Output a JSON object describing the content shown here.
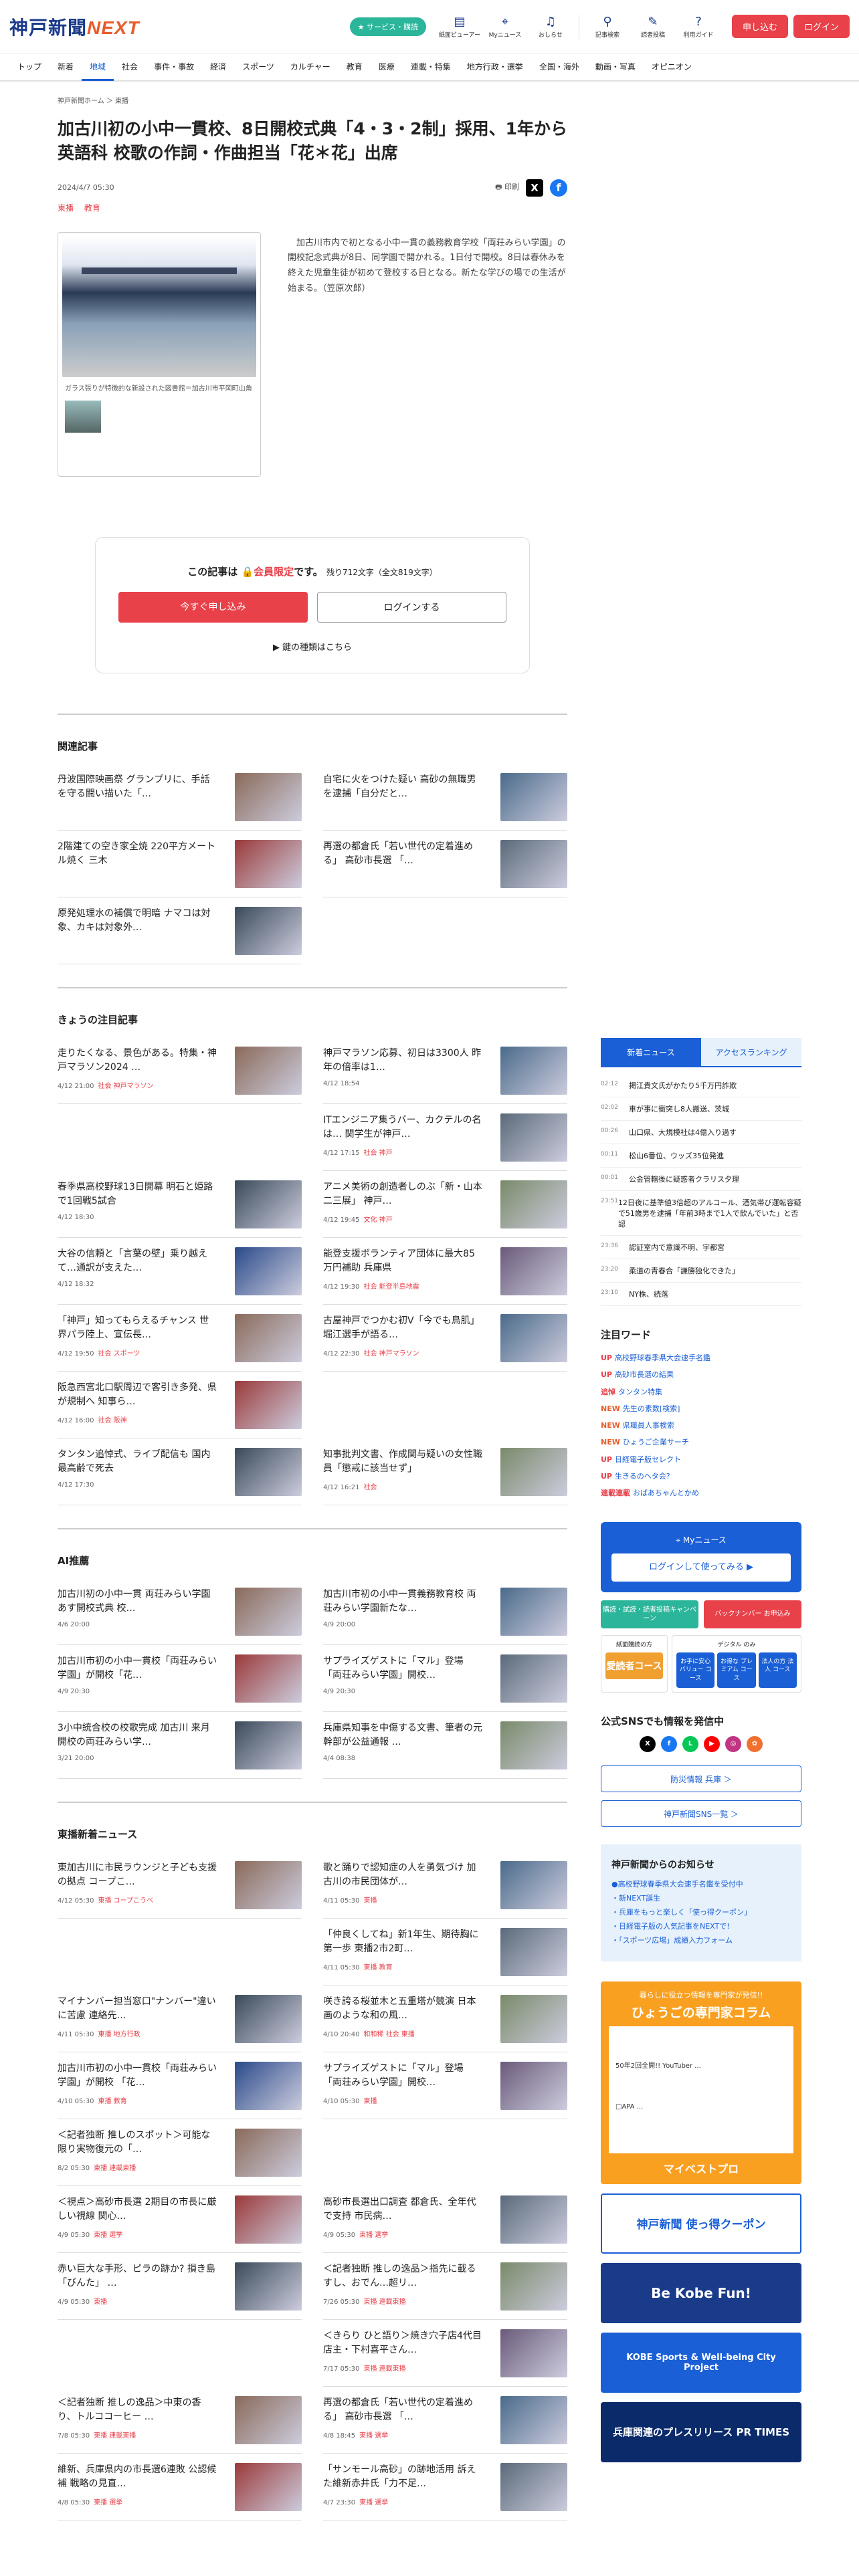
{
  "header": {
    "logo_main": "神戸新聞",
    "logo_sub": "NEXT",
    "service_pill": "★ サービス・購読",
    "icons": [
      {
        "icon": "newspaper-icon",
        "label": "紙面ビューアー"
      },
      {
        "icon": "my-news-icon",
        "label": "Myニュース"
      },
      {
        "icon": "bell-icon",
        "label": "おしらせ"
      }
    ],
    "icons2": [
      {
        "icon": "search-icon",
        "label": "記事検索"
      },
      {
        "icon": "pin-icon",
        "label": "読者投稿"
      },
      {
        "icon": "help-icon",
        "label": "利用ガイド"
      }
    ],
    "signup": "申し込む",
    "login": "ログイン"
  },
  "nav": [
    "トップ",
    "新着",
    "地域",
    "社会",
    "事件・事故",
    "経済",
    "スポーツ",
    "カルチャー",
    "教育",
    "医療",
    "連載・特集",
    "地方行政・選挙",
    "全国・海外",
    "動画・写真",
    "オピニオン"
  ],
  "nav_active": "地域",
  "article": {
    "breadcrumb": "神戸新聞ホーム ＞ 東播",
    "title": "加古川初の小中一貫校、8日開校式典「4・3・2制」採用、1年から英語科 校歌の作詞・作曲担当「花＊花」出席",
    "date": "2024/4/7 05:30",
    "print": "印刷",
    "tags": [
      "東播",
      "教育"
    ],
    "photo_caption": "ガラス張りが特徴的な新設された図書館＝加古川市平岡町山角",
    "lead": "加古川市内で初となる小中一貫の義務教育学校「両荘みらい学園」の開校記念式典が8日、同学園で開かれる。1日付で開校。8日は春休みを終えた児童生徒が初めて登校する日となる。新たな学びの場での生活が始まる。（笠原次郎）"
  },
  "paywall": {
    "msg_prefix": "この記事は",
    "msg_red": "会員限定",
    "msg_suffix": "です。",
    "remain": "残り712文字（全文819文字）",
    "apply": "今すぐ申し込み",
    "login": "ログインする",
    "key_link": "▶ 鍵の種類はこちら"
  },
  "related": {
    "heading": "関連記事",
    "items": [
      {
        "title": "丹波国際映画祭 グランプリに、手話を守る闘い描いた「…"
      },
      {
        "title": "自宅に火をつけた疑い 高砂の無職男を逮捕「自分だと…"
      },
      {
        "title": "2階建ての空き家全焼 220平方メートル焼く 三木"
      },
      {
        "title": "再選の都倉氏「若い世代の定着進める」 高砂市長選 「…"
      },
      {
        "title": "原発処理水の補償で明暗 ナマコは対象、カキは対象外…"
      }
    ]
  },
  "featured": {
    "heading": "きょうの注目記事",
    "items": [
      {
        "title": "走りたくなる、景色がある。特集・神戸マラソン2024 …",
        "time": "4/12 21:00",
        "cat": "社会 神戸マラソン"
      },
      {
        "title": "神戸マラソン応募、初日は3300人 昨年の倍率は1…",
        "time": "4/12 18:54",
        "cat": ""
      },
      {
        "title": "",
        "time": "",
        "cat": ""
      },
      {
        "title": "ITエンジニア集うバー、カクテルの名は… 関学生が神戸…",
        "time": "4/12 17:15",
        "cat": "社会 神戸"
      },
      {
        "title": "春季県高校野球13日開幕 明石と姫路で1回戦5試合",
        "time": "4/12 18:30",
        "cat": ""
      },
      {
        "title": "アニメ美術の創造者しのぶ「新・山本二三展」 神戸…",
        "time": "4/12 19:45",
        "cat": "文化 神戸"
      },
      {
        "title": "大谷の信頼と「言葉の壁」乗り越えて…通訳が支えた…",
        "time": "4/12 18:32",
        "cat": ""
      },
      {
        "title": "能登支援ボランティア団体に最大85万円補助 兵庫県",
        "time": "4/12 19:30",
        "cat": "社会 能登半島地震"
      },
      {
        "title": "「神戸」知ってもらえるチャンス 世界パラ陸上、宣伝長…",
        "time": "4/12 19:50",
        "cat": "社会 スポーツ"
      },
      {
        "title": "古屋神戸でつかむ初V「今でも鳥肌」 堀江選手が語る…",
        "time": "4/12 22:30",
        "cat": "社会 神戸マラソン"
      },
      {
        "title": "阪急西宮北口駅周辺で客引き多発、県が規制へ 知事ら…",
        "time": "4/12 16:00",
        "cat": "社会 阪神"
      },
      {
        "title": "",
        "time": "",
        "cat": ""
      },
      {
        "title": "タンタン追悼式、ライブ配信も 国内最高齢で死去",
        "time": "4/12 17:30",
        "cat": ""
      },
      {
        "title": "知事批判文書、作成関与疑いの女性職員「懲戒に該当せず」",
        "time": "4/12 16:21",
        "cat": "社会"
      }
    ]
  },
  "ai": {
    "heading": "AI推薦",
    "items": [
      {
        "title": "加古川初の小中一貫 両荘みらい学園 あす開校式典 校…",
        "time": "4/6 20:00",
        "cat": ""
      },
      {
        "title": "加古川市初の小中一貫義務教育校 両荘みらい学園新たな…",
        "time": "4/9 20:00",
        "cat": ""
      },
      {
        "title": "加古川市初の小中一貫校「両荘みらい学園」が開校「花…",
        "time": "4/9 20:30",
        "cat": ""
      },
      {
        "title": "サプライズゲストに「マル」登場 「両荘みらい学園」開校…",
        "time": "4/9 20:30",
        "cat": ""
      },
      {
        "title": "3小中統合校の校歌完成 加古川 来月開校の両荘みらい学…",
        "time": "3/21 20:00",
        "cat": ""
      },
      {
        "title": "兵庫県知事を中傷する文書、筆者の元幹部が公益通報 …",
        "time": "4/4 08:38",
        "cat": ""
      }
    ]
  },
  "tohban": {
    "heading": "東播新着ニュース",
    "items": [
      {
        "title": "東加古川に市民ラウンジと子ども支援の拠点 コープこ…",
        "time": "4/12 05:30",
        "cat": "東播 コープこうべ"
      },
      {
        "title": "歌と踊りで認知症の人を勇気づけ 加古川の市民団体が…",
        "time": "4/11 05:30",
        "cat": "東播"
      },
      {
        "title": "",
        "time": "",
        "cat": ""
      },
      {
        "title": "「仲良くしてね」新1年生、期待胸に第一歩 東播2市2町…",
        "time": "4/11 05:30",
        "cat": "東播 教育"
      },
      {
        "title": "マイナンバー担当窓口\"ナンバー\"違いに苦慮 連絡先…",
        "time": "4/11 05:30",
        "cat": "東播 地方行政"
      },
      {
        "title": "咲き誇る桜並木と五重塔が競演 日本画のような和の風…",
        "time": "4/10 20:40",
        "cat": "和和稀 社会 東播"
      },
      {
        "title": "加古川市初の小中一貫校「両荘みらい学園」が開校 「花…",
        "time": "4/10 05:30",
        "cat": "東播 教育"
      },
      {
        "title": "サプライズゲストに「マル」登場 「両荘みらい学園」開校…",
        "time": "4/10 05:30",
        "cat": "東播"
      },
      {
        "title": "＜記者独断 推しのスポット＞可能な限り実物復元の「…",
        "time": "8/2 05:30",
        "cat": "東播 連載東播"
      },
      {
        "title": "",
        "time": "",
        "cat": ""
      },
      {
        "title": "＜視点＞高砂市長選 2期目の市長に厳しい視線 関心…",
        "time": "4/9 05:30",
        "cat": "東播 選挙"
      },
      {
        "title": "高砂市長選出口調査 都倉氏、全年代で支持 市民病…",
        "time": "4/9 05:30",
        "cat": "東播 選挙"
      },
      {
        "title": "赤い巨大な手形、ピラの跡か? 損き島「びんた」 …",
        "time": "4/9 05:30",
        "cat": "東播"
      },
      {
        "title": "＜記者独断 推しの逸品＞指先に載るすし、おでん…超リ…",
        "time": "7/26 05:30",
        "cat": "東播 連載東播"
      },
      {
        "title": "",
        "time": "",
        "cat": ""
      },
      {
        "title": "＜きらり ひと語り＞焼き穴子店4代目店主・下村喜平さん…",
        "time": "7/17 05:30",
        "cat": "東播 連載東播"
      },
      {
        "title": "＜記者独断 推しの逸品＞中東の香り、トルココーヒー …",
        "time": "7/8 05:30",
        "cat": "東播 連載東播"
      },
      {
        "title": "再選の都倉氏「若い世代の定着進める」 高砂市長選 「…",
        "time": "4/8 18:45",
        "cat": "東播 選挙"
      },
      {
        "title": "維新、兵庫県内の市長選6連敗 公認候補 戦略の見直…",
        "time": "4/8 05:30",
        "cat": "東播 選挙"
      },
      {
        "title": "「サンモール高砂」の跡地活用 訴えた維新赤井氏「力不足…",
        "time": "4/7 23:30",
        "cat": "東播 選挙"
      }
    ]
  },
  "sidebar": {
    "tab_new": "新着ニュース",
    "tab_rank": "アクセスランキング",
    "news": [
      {
        "t": "02:12",
        "title": "掲江貴文氏がかたり5千万円詐欺"
      },
      {
        "t": "02:02",
        "title": "車が事に衝突し8人搬送、茨城"
      },
      {
        "t": "00:26",
        "title": "山口県、大規模社は4億入り過す"
      },
      {
        "t": "00:11",
        "title": "松山6番位、ウッズ35位発進"
      },
      {
        "t": "00:01",
        "title": "公金管轄後に疑惑者クラリス夕理"
      },
      {
        "t": "23:51",
        "title": "12日夜に基準値3倍超のアルコール、酒気帯び運転容疑で51歳男を逮捕「年前3時まで1人で飲んでいた」と否認"
      },
      {
        "t": "23:36",
        "title": "認証室内で意識不明、宇都宮"
      },
      {
        "t": "23:20",
        "title": "柔道の青春合「謙勝独化できた」"
      },
      {
        "t": "23:10",
        "title": "NY株、続落"
      }
    ],
    "kw_heading": "注目ワード",
    "keywords": [
      {
        "badge": "UP",
        "kind": "hot",
        "text": "高校野球春季県大会速手名鑑"
      },
      {
        "badge": "UP",
        "kind": "hot",
        "text": "高砂市長選の結果"
      },
      {
        "badge": "追悼",
        "kind": "hot",
        "text": "タンタン特集"
      },
      {
        "badge": "NEW",
        "kind": "new",
        "text": "先生の素数[検索]"
      },
      {
        "badge": "NEW",
        "kind": "new",
        "text": "県職員人事検索"
      },
      {
        "badge": "NEW",
        "kind": "new",
        "text": "ひょうご企業サーチ"
      },
      {
        "badge": "UP",
        "kind": "hot",
        "text": "日経電子版セレクト"
      },
      {
        "badge": "UP",
        "kind": "hot",
        "text": "生きるのヘタ会?"
      },
      {
        "badge": "連載連載",
        "kind": "hot",
        "text": "おばあちゃんとかめ"
      }
    ],
    "my_title": "Myニュース",
    "my_btn": "ログインして使ってみる ▶",
    "mini1": "購読・試読・読者投稿キャンペーン",
    "mini2": "バックナンバー お申込み",
    "plan_a_h": "紙面購読の方",
    "plan_a": "愛読者コース",
    "plan_b_h": "デジタル のみ",
    "plan_b": [
      "お手に安心 バリュー コース",
      "お得な プレミアム コース",
      "法人の方 法人 コース"
    ],
    "sns_heading": "公式SNSでも情報を発信中",
    "sns": [
      "X",
      "f",
      "L",
      "▶",
      "◎",
      "✿"
    ],
    "out1": "防災情報 兵庫 ＞",
    "out2": "神戸新聞SNS一覧 ＞",
    "notice_h": "神戸新聞からのお知らせ",
    "notices": [
      "●高校野球春季県大会速手名鑑を受付中",
      "・新NEXT誕生",
      "・兵庫をもっと楽しく「使っ得クーポン」",
      "・日経電子版の人気記事をNEXTで!",
      "・「スポーツ広場」成績入力フォーム"
    ],
    "ad_h1": "暮らしに役立つ情報を専門家が発信!!",
    "ad_h2": "ひょうごの専門家コラム",
    "ad_line1": "50年2回全開!! YouTuber ...",
    "ad_line2": "□APA ...",
    "ad_foot": "マイベストプロ",
    "banners": [
      "神戸新聞 使っ得クーポン",
      "Be Kobe Fun!",
      "KOBE Sports & Well-being City Project",
      "兵庫関連のプレスリリース PR TIMES"
    ]
  }
}
